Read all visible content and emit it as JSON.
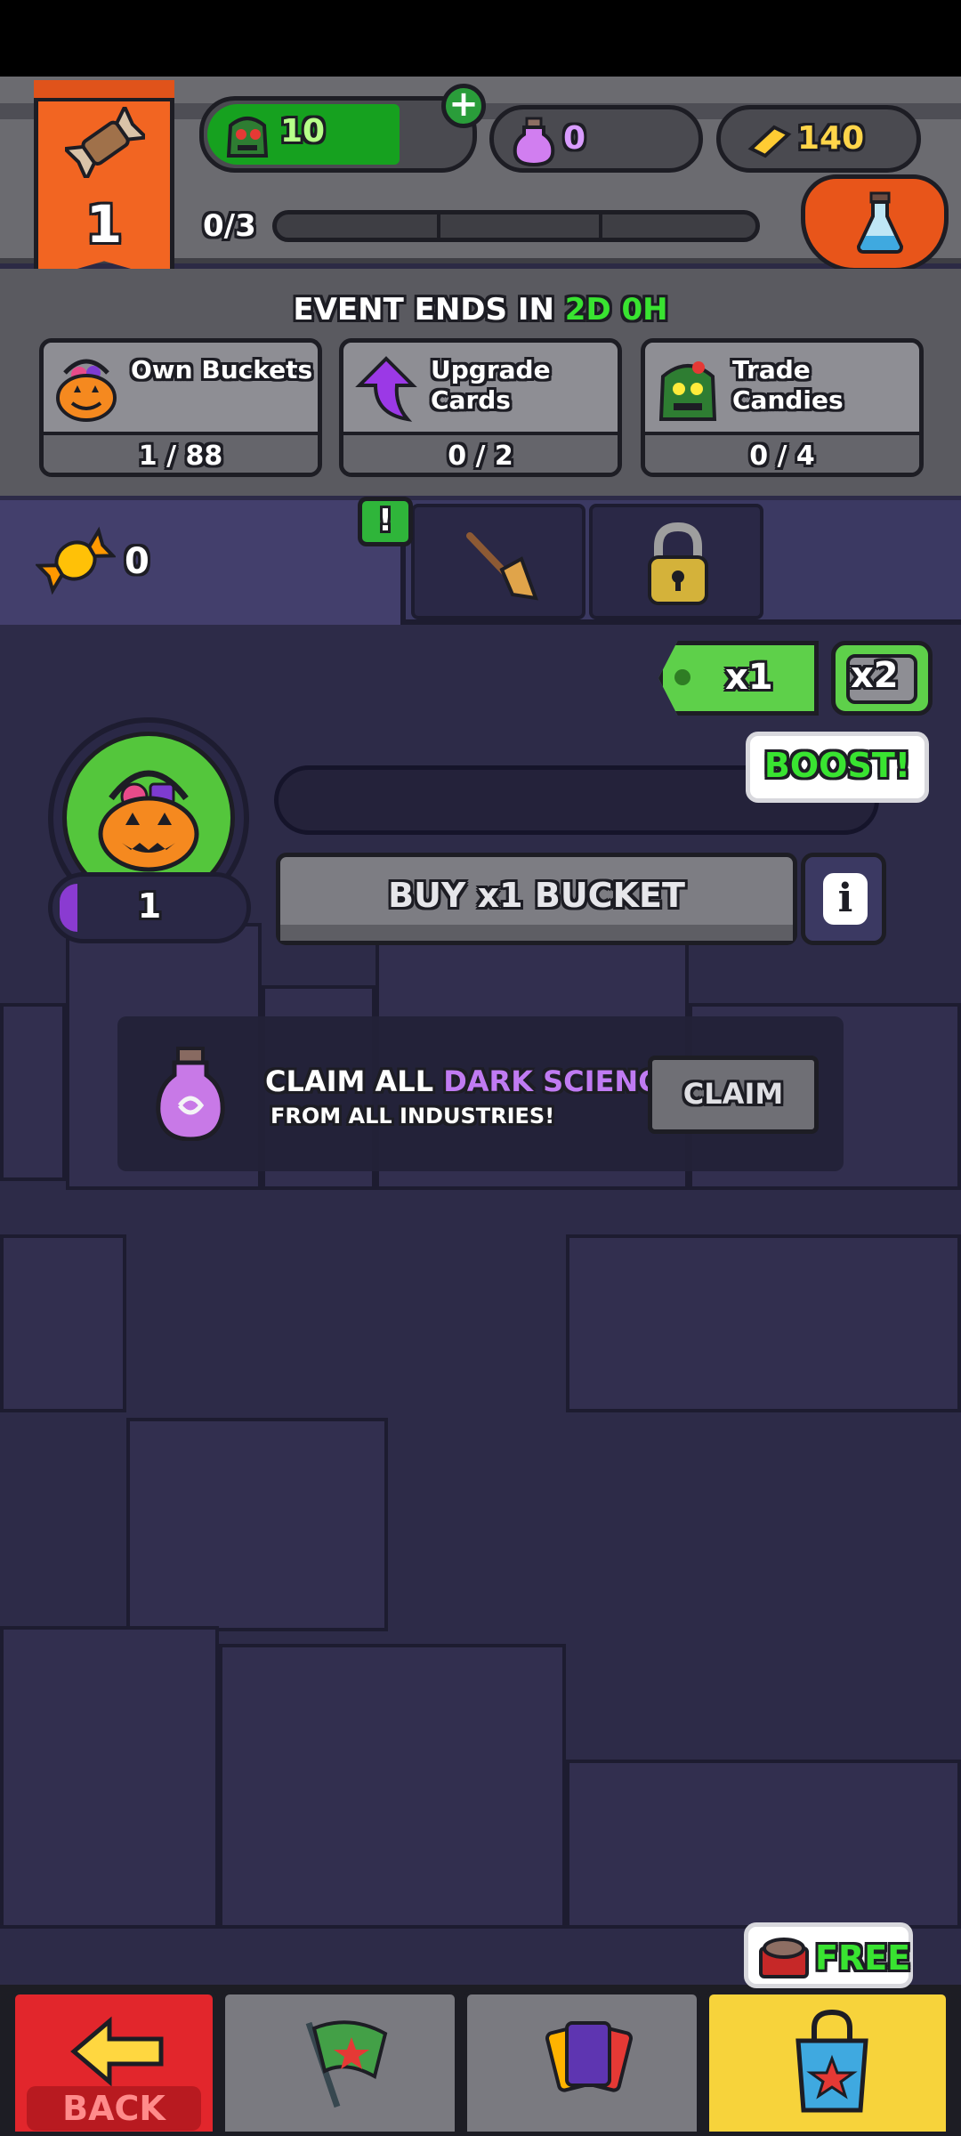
{
  "header": {
    "level": "1",
    "resources": {
      "green": "10",
      "purple": "0",
      "gold": "140"
    },
    "progress_label": "0/3"
  },
  "event": {
    "timer_prefix": "EVENT ENDS IN",
    "timer_value": "2D 0H",
    "quests": [
      {
        "label": "Own Buckets",
        "count": "1 / 88"
      },
      {
        "label": "Upgrade Cards",
        "count": "0 / 2"
      },
      {
        "label": "Trade Candies",
        "count": "0 / 4"
      }
    ]
  },
  "items": {
    "candy_count": "0",
    "alert": "!"
  },
  "multiplier": {
    "x1": "x1",
    "x2": "x2",
    "boost": "BOOST!"
  },
  "bucket": {
    "level": "1",
    "buy_label": "BUY x1 BUCKET",
    "info": "i"
  },
  "claim": {
    "title_prefix": "CLAIM ALL",
    "title_highlight": "DARK SCIENCE",
    "subtitle": "FROM ALL INDUSTRIES!",
    "button": "CLAIM"
  },
  "nav": {
    "back": "BACK",
    "free": "FREE"
  },
  "colors": {
    "accent_green": "#39e331",
    "banner_orange": "#f26522",
    "purple": "#c07bf2",
    "shop_yellow": "#f7d33b",
    "back_red": "#e2262c"
  }
}
